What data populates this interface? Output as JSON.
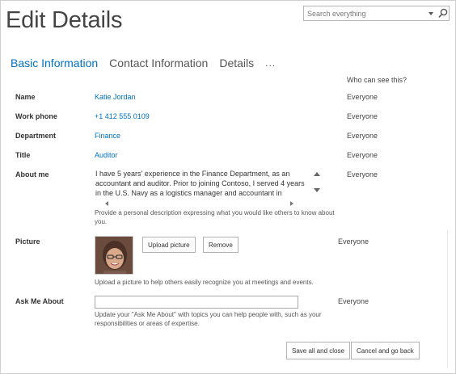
{
  "page": {
    "title": "Edit Details"
  },
  "search": {
    "placeholder": "Search everything"
  },
  "tabs": [
    {
      "label": "Basic Information",
      "active": true
    },
    {
      "label": "Contact Information",
      "active": false
    },
    {
      "label": "Details",
      "active": false
    }
  ],
  "tabs_more": "...",
  "who_can_see_header": "Who can see this?",
  "fields": {
    "name": {
      "label": "Name",
      "value": "Katie Jordan",
      "visibility": "Everyone"
    },
    "work_phone": {
      "label": "Work phone",
      "value": "+1 412 555 0109",
      "visibility": "Everyone"
    },
    "department": {
      "label": "Department",
      "value": "Finance",
      "visibility": "Everyone"
    },
    "title": {
      "label": "Title",
      "value": "Auditor",
      "visibility": "Everyone"
    },
    "about_me": {
      "label": "About me",
      "value": "I have 5 years' experience in the Finance Department, as an accountant and auditor. Prior to joining Contoso, I served 4 years in the U.S. Navy as a logistics manager and accountant in",
      "hint": "Provide a personal description expressing what you would like others to know about you.",
      "visibility": "Everyone"
    },
    "picture": {
      "label": "Picture",
      "upload_button": "Upload picture",
      "remove_button": "Remove",
      "hint": "Upload a picture to help others easily recognize you at meetings and events.",
      "visibility": "Everyone"
    },
    "ask_me_about": {
      "label": "Ask Me About",
      "value": "",
      "hint": "Update your \"Ask Me About\" with topics you can help people with, such as your responsibilities or areas of expertise.",
      "visibility": "Everyone"
    }
  },
  "footer": {
    "save_button": "Save all and close",
    "cancel_button": "Cancel and go back"
  },
  "colors": {
    "accent": "#0072c6",
    "text": "#333333",
    "border": "#b3b3b3"
  },
  "icons": {
    "search": "search-icon",
    "dropdown": "chevron-down-icon"
  }
}
